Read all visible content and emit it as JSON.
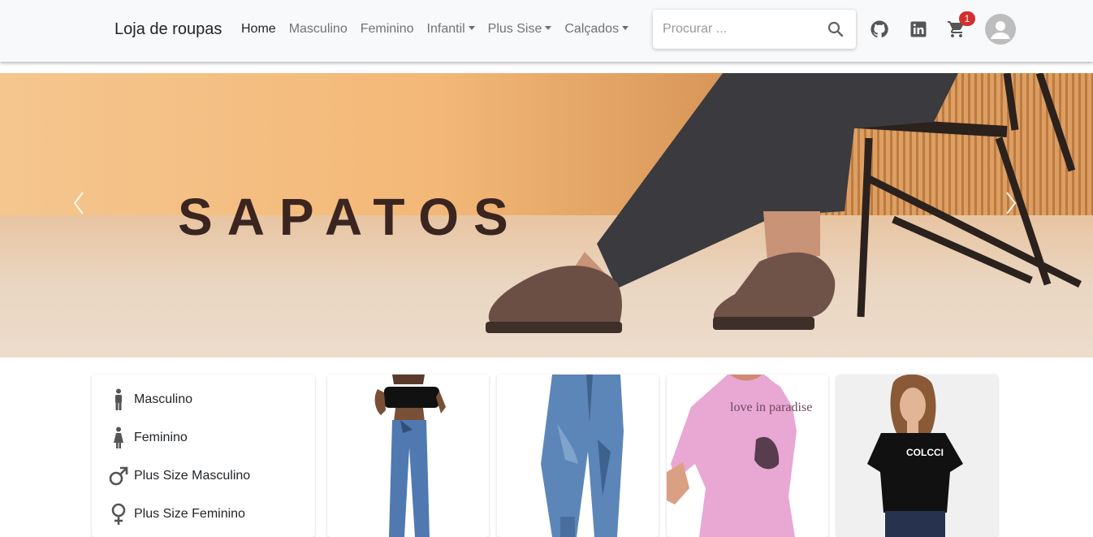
{
  "navbar": {
    "brand": "Loja de roupas",
    "links": [
      {
        "label": "Home",
        "dropdown": false,
        "active": true
      },
      {
        "label": "Masculino",
        "dropdown": false
      },
      {
        "label": "Feminino",
        "dropdown": false
      },
      {
        "label": "Infantil",
        "dropdown": true
      },
      {
        "label": "Plus Sise",
        "dropdown": true
      },
      {
        "label": "Calçados",
        "dropdown": true
      }
    ],
    "search": {
      "placeholder": "Procurar ...",
      "value": ""
    },
    "icons": [
      "github-icon",
      "linkedin-icon",
      "cart-icon",
      "avatar-icon"
    ],
    "cart_count": "1",
    "accent_colors": {
      "badge": "#d32f2f",
      "navbar_bg": "#f8f9fa"
    }
  },
  "hero": {
    "title": "SAPATOS",
    "controls": [
      "chevron-left-icon",
      "chevron-right-icon"
    ]
  },
  "categories": {
    "items": [
      {
        "label": "Masculino",
        "icon": "man-icon"
      },
      {
        "label": "Feminino",
        "icon": "woman-icon"
      },
      {
        "label": "Plus Size Masculino",
        "icon": "male-symbol-icon"
      },
      {
        "label": "Plus Size Feminino",
        "icon": "female-symbol-icon"
      }
    ]
  },
  "products": [
    {
      "image": "woman-jeans-black-top-photo"
    },
    {
      "image": "jeans-jogger-photo"
    },
    {
      "image": "pink-tshirt-photo"
    },
    {
      "image": "black-tshirt-photo"
    }
  ],
  "product_texts": {
    "print_pink": "love in paradise",
    "print_black": "COLCCI"
  }
}
